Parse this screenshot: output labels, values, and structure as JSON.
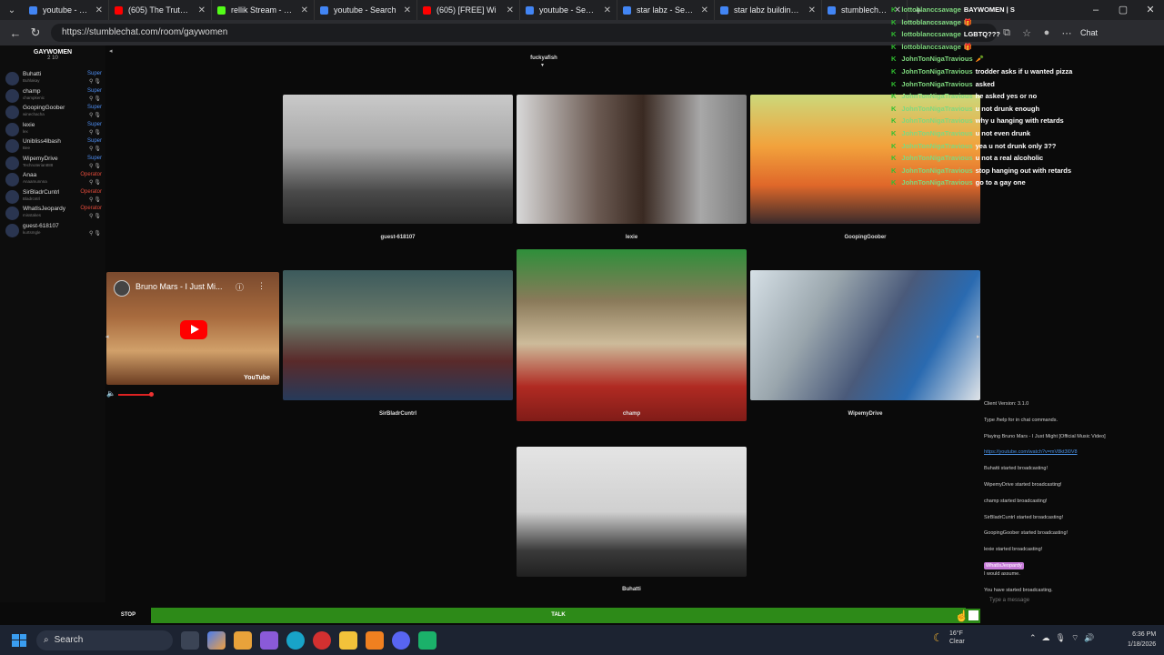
{
  "browser": {
    "tabs": [
      {
        "title": "youtube - Search",
        "color": "#4285f4"
      },
      {
        "title": "(605) The Truth Abo",
        "color": "#ff0000"
      },
      {
        "title": "rellik Stream - Watch",
        "color": "#53fc18"
      },
      {
        "title": "youtube - Search",
        "color": "#4285f4"
      },
      {
        "title": "(605) [FREE] Wi",
        "color": "#ff0000"
      },
      {
        "title": "youtube - Search",
        "color": "#4285f4"
      },
      {
        "title": "star labz - Search",
        "color": "#4285f4"
      },
      {
        "title": "star labz building - S",
        "color": "#4285f4"
      },
      {
        "title": "stumblechat.com",
        "color": "#4285f4"
      }
    ],
    "url": "https://stumblechat.com/room/gaywomen",
    "chat_label": "Chat"
  },
  "room": {
    "title": "GAYWOMEN",
    "count": "2 10",
    "top_user": "fuckyafish"
  },
  "users": [
    {
      "name": "Buhatti",
      "sub": "Buhlakay",
      "role": "Super",
      "role_color": "#4d8df0"
    },
    {
      "name": "champ",
      "sub": "champkenic",
      "role": "Super",
      "role_color": "#4d8df0"
    },
    {
      "name": "GoopingGoober",
      "sub": "winechacha",
      "role": "Super",
      "role_color": "#4d8df0"
    },
    {
      "name": "lexie",
      "sub": "lex",
      "role": "Super",
      "role_color": "#4d8df0"
    },
    {
      "name": "Unibliss4lbash",
      "sub": "Bee",
      "role": "Super",
      "role_color": "#4d8df0"
    },
    {
      "name": "WipemyDrive",
      "sub": "Technoterian888",
      "role": "Super",
      "role_color": "#4d8df0"
    },
    {
      "name": "Anaa",
      "sub": "Anaamunnna",
      "role": "Operator",
      "role_color": "#e04a3a"
    },
    {
      "name": "SirBladrCuntrl",
      "sub": "Bladrcntrl",
      "role": "Operator",
      "role_color": "#e04a3a"
    },
    {
      "name": "WhatIsJeopardy",
      "sub": "misstakes",
      "role": "Operator",
      "role_color": "#e04a3a"
    },
    {
      "name": "guest-618107",
      "sub": "kurtsmgle",
      "role": "",
      "role_color": "#888"
    }
  ],
  "cams": [
    {
      "label": "guest-618107"
    },
    {
      "label": "lexie"
    },
    {
      "label": "GoopingGoober"
    },
    {
      "label": "SirBladrCuntrl"
    },
    {
      "label": "champ"
    },
    {
      "label": "WipemyDrive"
    },
    {
      "label": "Buhatti"
    }
  ],
  "youtube": {
    "title": "Bruno Mars - I Just Mi...",
    "brand": "YouTube"
  },
  "overlay_chat": [
    {
      "user": "lottoblanccsavage",
      "msg": "BAYWOMEN | S"
    },
    {
      "user": "lottoblanccsavage",
      "msg": "🎁"
    },
    {
      "user": "lottoblanccsavage",
      "msg": "LGBTQ???"
    },
    {
      "user": "lottoblanccsavage",
      "msg": "🎁"
    },
    {
      "user": "JohnTonNigaTravious",
      "msg": "🥕"
    },
    {
      "user": "JohnTonNigaTravious",
      "msg": "trodder asks if u wanted pizza"
    },
    {
      "user": "JohnTonNigaTravious",
      "msg": "asked"
    },
    {
      "user": "JohnTonNigaTravious",
      "msg": "he asked yes or no"
    },
    {
      "user": "JohnTonNigaTravious",
      "msg": "u not drunk enough"
    },
    {
      "user": "JohnTonNigaTravious",
      "msg": "why u hanging with retards"
    },
    {
      "user": "JohnTonNigaTravious",
      "msg": "u not even drunk"
    },
    {
      "user": "JohnTonNigaTravious",
      "msg": "yea u not drunk only 3??"
    },
    {
      "user": "JohnTonNigaTravious",
      "msg": "u not a real alcoholic"
    },
    {
      "user": "JohnTonNigaTravious",
      "msg": "stop hanging out with retards"
    },
    {
      "user": "JohnTonNigaTravious",
      "msg": "go to a gay one"
    }
  ],
  "log": [
    {
      "text": "Client Version: 3.1.0",
      "kind": "normal"
    },
    {
      "text": "Type /help for in chat commands.",
      "kind": "normal"
    },
    {
      "text": "Playing Bruno Mars - I Just Might [Official Music Video]",
      "kind": "normal"
    },
    {
      "text": "https://youtube.com/watch?v=mV8kt3l0V8",
      "kind": "link"
    },
    {
      "text": "Buhatti started broadcasting!",
      "kind": "normal"
    },
    {
      "text": "WipemyDrive started broadcasting!",
      "kind": "normal"
    },
    {
      "text": "champ started broadcasting!",
      "kind": "normal"
    },
    {
      "text": "SirBladrCuntrl started broadcasting!",
      "kind": "normal"
    },
    {
      "text": "GoopingGoober started broadcasting!",
      "kind": "normal"
    },
    {
      "text": "lexie started broadcasting!",
      "kind": "normal"
    },
    {
      "text": "WhatIsJeopardy",
      "kind": "tag"
    },
    {
      "text": "I would assume.",
      "kind": "normal"
    },
    {
      "text": "You have started broadcasting.",
      "kind": "normal"
    }
  ],
  "input": {
    "placeholder": "Type a message"
  },
  "controls": {
    "stop": "STOP",
    "talk": "TALK"
  },
  "taskbar": {
    "search": "Search",
    "weather_temp": "16°F",
    "weather_desc": "Clear",
    "time": "6:36 PM",
    "date": "1/18/2026"
  }
}
